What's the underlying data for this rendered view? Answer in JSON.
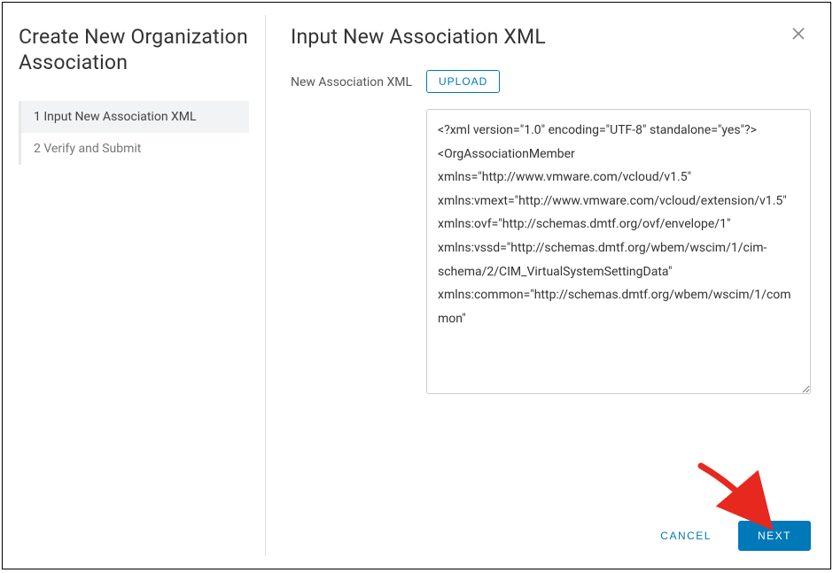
{
  "sidebar": {
    "title": "Create New Organization Association",
    "steps": [
      {
        "num": "1",
        "label": "Input New Association XML"
      },
      {
        "num": "2",
        "label": "Verify and Submit"
      }
    ]
  },
  "main": {
    "title": "Input New Association XML",
    "field_label": "New Association XML",
    "upload_label": "UPLOAD",
    "xml_value": "<?xml version=\"1.0\" encoding=\"UTF-8\" standalone=\"yes\"?>\n<OrgAssociationMember xmlns=\"http://www.vmware.com/vcloud/v1.5\" xmlns:vmext=\"http://www.vmware.com/vcloud/extension/v1.5\" xmlns:ovf=\"http://schemas.dmtf.org/ovf/envelope/1\" xmlns:vssd=\"http://schemas.dmtf.org/wbem/wscim/1/cim-schema/2/CIM_VirtualSystemSettingData\" xmlns:common=\"http://schemas.dmtf.org/wbem/wscim/1/common\""
  },
  "footer": {
    "cancel_label": "CANCEL",
    "next_label": "NEXT"
  }
}
